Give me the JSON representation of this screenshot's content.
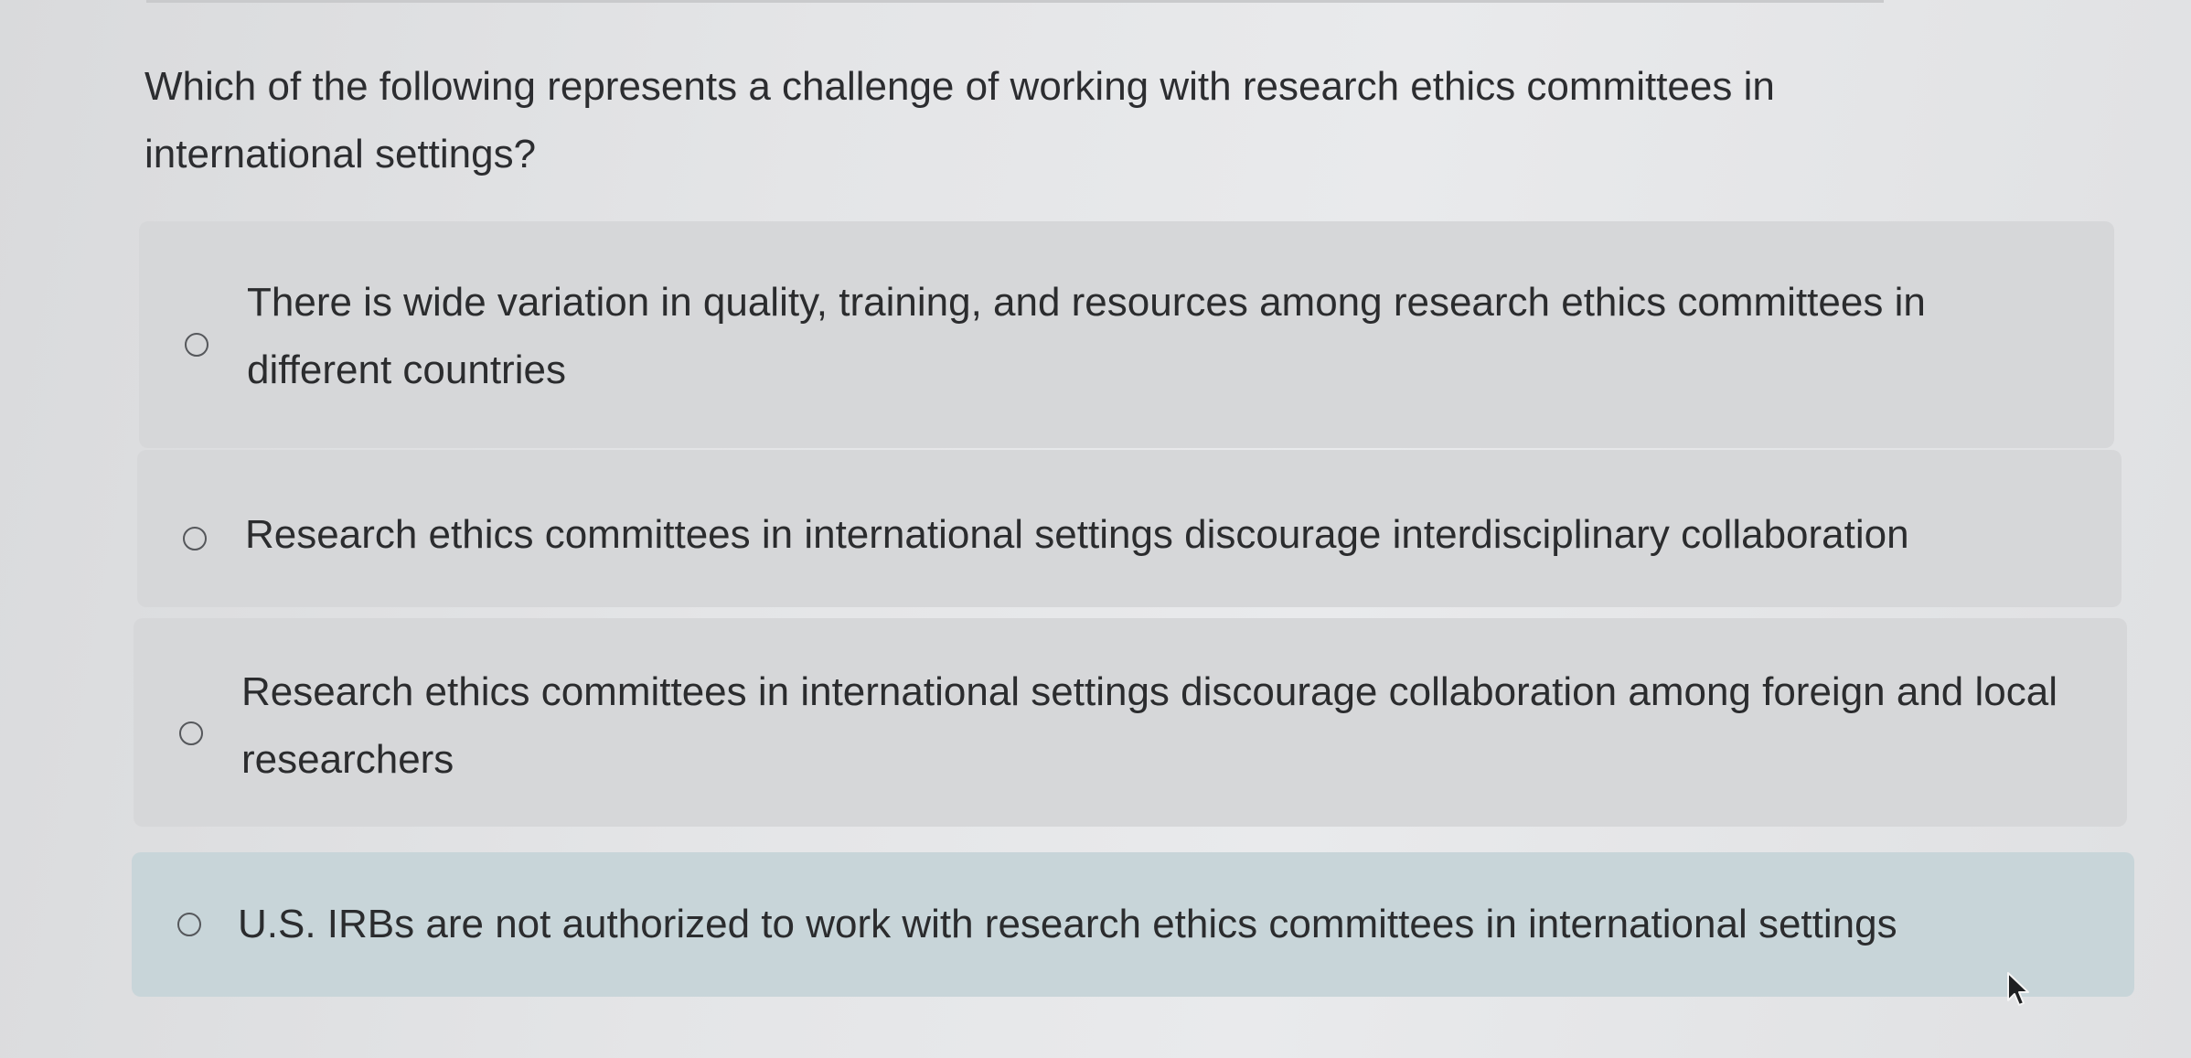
{
  "question": {
    "text": "Which of the following represents a challenge of working with research ethics committees in international settings?"
  },
  "options": [
    {
      "label": "There is wide variation in quality, training, and resources among research ethics committees in different countries",
      "selected": false
    },
    {
      "label": "Research ethics committees in international settings discourage interdisciplinary collaboration",
      "selected": false
    },
    {
      "label": "Research ethics committees in international settings discourage collaboration among foreign and local researchers",
      "selected": false
    },
    {
      "label": "U.S. IRBs are not authorized to work with research ethics committees in international settings",
      "selected": false
    }
  ],
  "colors": {
    "option_background": "#d6d7d9",
    "option_hover_background": "#c8d5d9",
    "text": "#2b2c2e"
  },
  "icons": {
    "radio": "radio-unchecked-icon",
    "pointer": "mouse-pointer-icon"
  }
}
